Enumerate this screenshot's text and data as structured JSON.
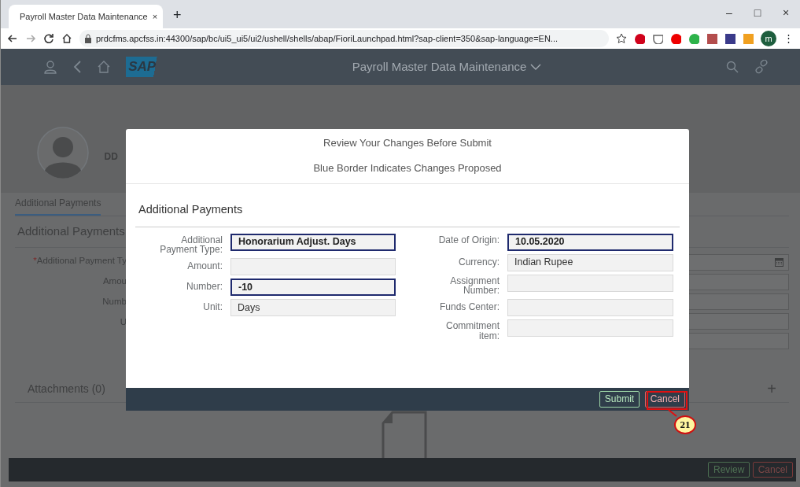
{
  "browser": {
    "tab_title": "Payroll Master Data Maintenance",
    "tab_close": "×",
    "new_tab": "+",
    "window_controls": [
      "–",
      "□",
      "×"
    ],
    "url": "prdcfms.apcfss.in:44300/sap/bc/ui5_ui5/ui2/ushell/shells/abap/FioriLaunchpad.html?sap-client=350&sap-language=EN...",
    "profile_initial": "m",
    "menu": "⋮"
  },
  "shell": {
    "logo": "SAP",
    "title": "Payroll Master Data Maintenance"
  },
  "background": {
    "employee_name": "DD",
    "tabs": [
      {
        "label": "Additional Payments",
        "selected": true
      }
    ],
    "section_title": "Additional Payments",
    "fields": [
      {
        "label": "Additional Payment Ty",
        "required_mark": "*"
      },
      {
        "label": "Amou"
      },
      {
        "label": "Numb"
      },
      {
        "label": "U"
      }
    ],
    "attachments_title": "Attachments (0)",
    "add": "+",
    "footer_buttons": [
      {
        "label": "Review",
        "kind": "accept"
      },
      {
        "label": "Cancel",
        "kind": "reject"
      }
    ]
  },
  "dialog": {
    "title": "Review Your Changes Before Submit",
    "subtitle": "Blue Border Indicates Changes Proposed",
    "section_title": "Additional Payments",
    "left_fields": [
      {
        "label": "Additional Payment Type:",
        "value": "Honorarium Adjust. Days",
        "changed": true
      },
      {
        "label": "Amount:",
        "changed": false
      },
      {
        "label": "Number:",
        "value": "-10",
        "changed": true
      },
      {
        "label": "Unit:",
        "value": "Days",
        "changed": false
      }
    ],
    "right_fields": [
      {
        "label": "Date of Origin:",
        "value": "10.05.2020",
        "changed": true
      },
      {
        "label": "Currency:",
        "value": "Indian Rupee",
        "changed": false
      },
      {
        "label": "Assignment Number:",
        "changed": false
      },
      {
        "label": "Funds Center:",
        "changed": false
      },
      {
        "label": "Commitment item:",
        "changed": false
      }
    ],
    "buttons": [
      {
        "label": "Submit",
        "kind": "accept"
      },
      {
        "label": "Cancel",
        "kind": "reject"
      }
    ]
  },
  "callout": {
    "number": "21"
  }
}
